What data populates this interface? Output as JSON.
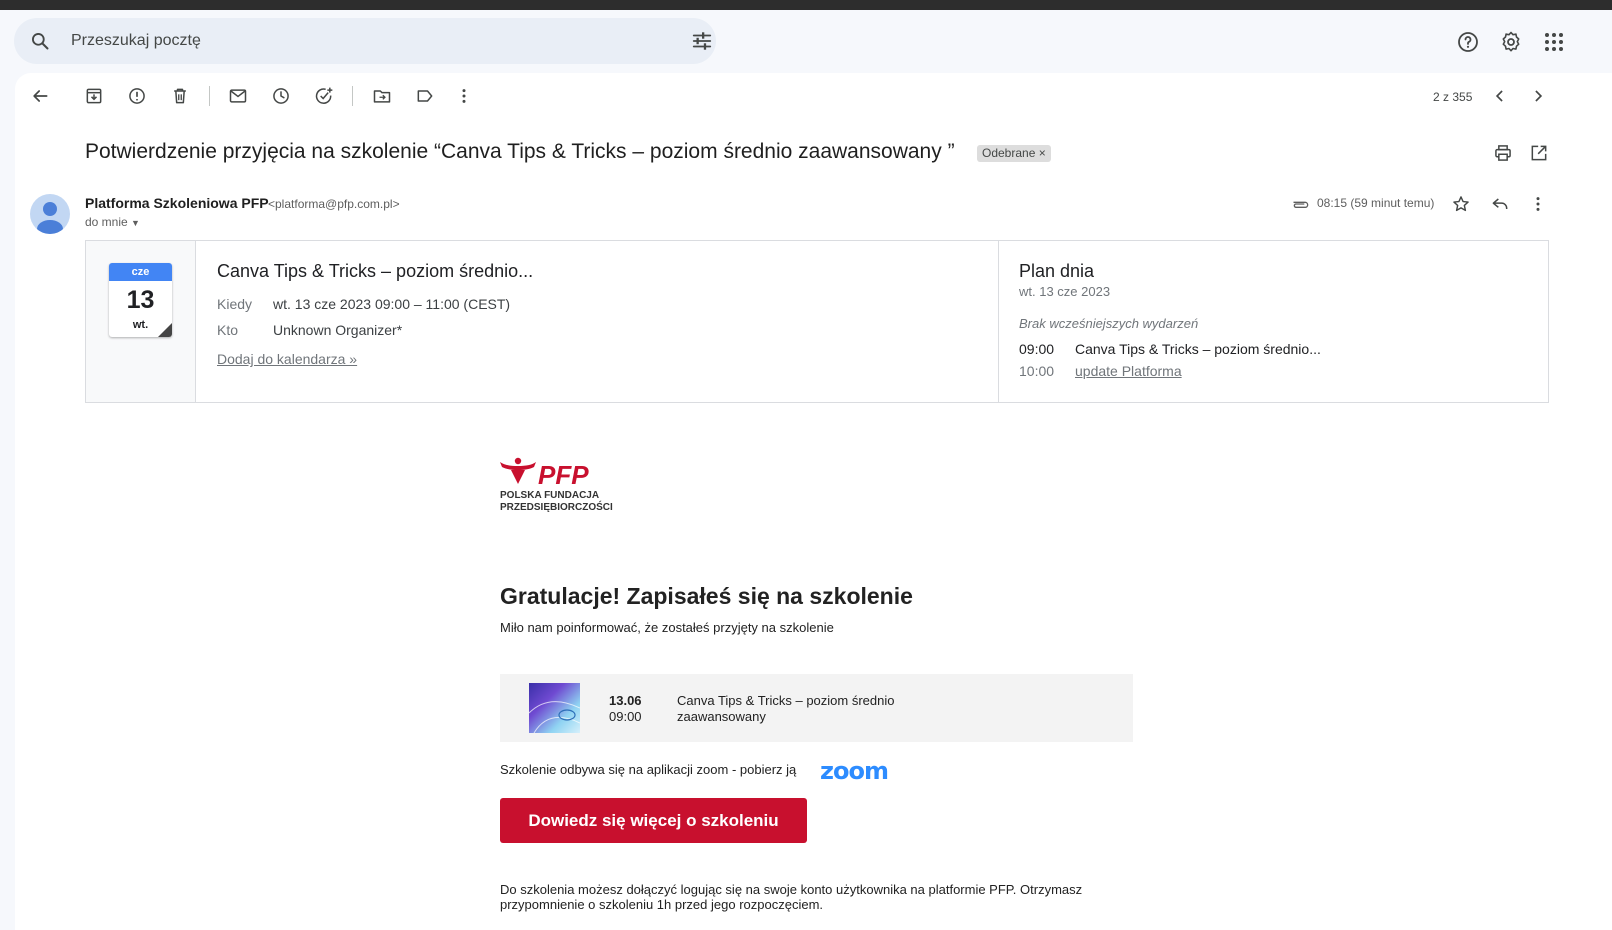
{
  "search": {
    "placeholder": "Przeszukaj pocztę",
    "search_icon": "search-icon",
    "tune_icon": "tune-icon"
  },
  "header_icons": [
    "help-icon",
    "settings-icon",
    "apps-icon"
  ],
  "toolbar": {
    "icons": [
      "back-icon",
      "archive-icon",
      "report-spam-icon",
      "delete-icon",
      "mark-unread-icon",
      "snooze-icon",
      "add-task-icon",
      "move-to-icon",
      "label-icon",
      "more-icon"
    ],
    "counter": "2 z 355"
  },
  "email": {
    "subject": "Potwierdzenie przyjęcia na szkolenie “Canva Tips & Tricks – poziom średnio zaawansowany ”",
    "label": "Odebrane",
    "sender_name": "Platforma Szkoleniowa PFP",
    "sender_email": "<platforma@pfp.com.pl>",
    "to": "do mnie",
    "time": "08:15 (59 minut temu)"
  },
  "invite": {
    "cal_month": "cze",
    "cal_day": "13",
    "cal_dow": "wt.",
    "title": "Canva Tips & Tricks – poziom średnio...",
    "when_label": "Kiedy",
    "when_value": "wt. 13 cze 2023 09:00 – 11:00 (CEST)",
    "who_label": "Kto",
    "who_value": "Unknown Organizer*",
    "add_link": "Dodaj do kalendarza »",
    "plan_title": "Plan dnia",
    "plan_date": "wt. 13 cze 2023",
    "plan_none": "Brak wcześniejszych wydarzeń",
    "events": [
      {
        "time": "09:00",
        "name": "Canva Tips & Tricks – poziom średnio..."
      },
      {
        "time": "10:00",
        "name": "update Platforma"
      }
    ]
  },
  "body": {
    "logo_text": "PFP",
    "logo_sub_1": "POLSKA FUNDACJA",
    "logo_sub_2": "PRZEDSIĘBIORCZOŚCI",
    "heading": "Gratulacje! Zapisałeś się na szkolenie",
    "intro": "Miło nam poinformować, że zostałeś przyjęty na szkolenie",
    "course_date": "13.06",
    "course_hour": "09:00",
    "course_name": "Canva Tips & Tricks – poziom średnio zaawansowany",
    "zoom_text": "Szkolenie odbywa się na aplikacji zoom - pobierz ją",
    "zoom_logo": "zoom",
    "cta": "Dowiedz się więcej o szkoleniu",
    "footer": "Do szkolenia możesz dołączyć logując się na swoje konto użytkownika na platformie PFP. Otrzymasz przypomnienie o szkoleniu 1h przed jego rozpoczęciem."
  },
  "colors": {
    "accent_red": "#c8102e",
    "zoom_blue": "#2d8cff",
    "calendar_blue": "#4285f4"
  }
}
